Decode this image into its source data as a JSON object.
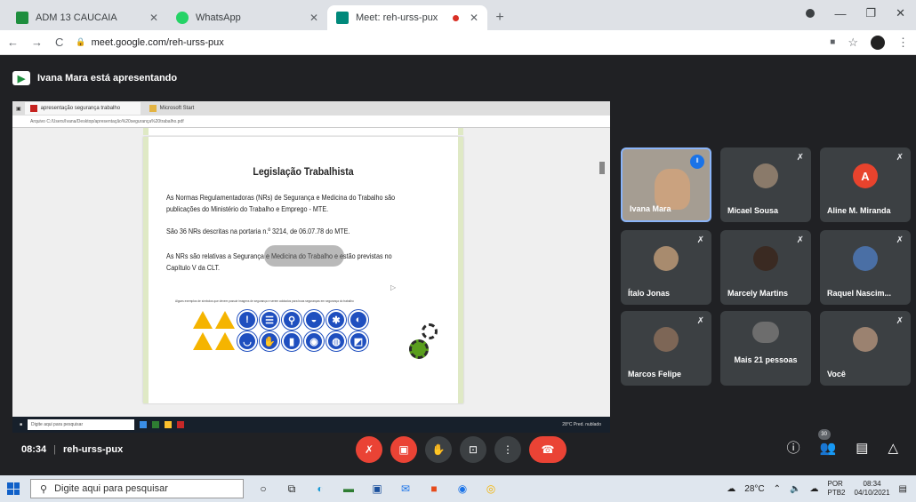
{
  "browser": {
    "tabs": [
      {
        "label": "ADM 13 CAUCAIA",
        "favicon_color": "#1e8e3e",
        "active": false
      },
      {
        "label": "WhatsApp",
        "favicon_color": "#25d366",
        "active": false
      },
      {
        "label": "Meet: reh-urss-pux",
        "favicon_color": "#00897b",
        "active": true
      }
    ],
    "new_tab": "+",
    "url": "meet.google.com/reh-urss-pux"
  },
  "meet": {
    "presenter_banner": "Ivana Mara está apresentando",
    "meeting_time": "08:34",
    "meeting_code": "reh-urss-pux",
    "people_count": "30",
    "participants": [
      {
        "name": "Ivana Mara",
        "speaking": true
      },
      {
        "name": "Micael Sousa"
      },
      {
        "name": "Aline M. Miranda",
        "initial": "A"
      },
      {
        "name": "Ítalo Jonas"
      },
      {
        "name": "Marcely Martins"
      },
      {
        "name": "Raquel Nascim..."
      },
      {
        "name": "Marcos Felipe"
      },
      {
        "name": "Mais 21 pessoas"
      },
      {
        "name": "Você"
      }
    ]
  },
  "shared_screen": {
    "tabs": [
      "apresentação segurança trabalho",
      "Microsoft Start"
    ],
    "address": "Arquivo  C:/Users/Ivana/Desktop/apresentação%20segurança%20trabalho.pdf",
    "slide": {
      "title": "Legislação Trabalhista",
      "p1": "As Normas Regulamentadoras (NRs) de Segurança e Medicina do Trabalho são publicações do Ministério do Trabalho e Emprego - MTE.",
      "p2": "São 36 NRs descritas na portaria n.º 3214, de 06.07.78 do MTE.",
      "p3": "As NRs são relativas a Segurança e Medicina do Trabalho e estão previstas no Capítulo V da CLT.",
      "small": "Alguns exemplos de símbolos que devem possuir imagens de segurança e serem adotados para boas seguranças em segurança do trabalho"
    },
    "taskbar": {
      "search": "Digite aqui para pesquisar",
      "tray": "28°C Pred. nublado"
    }
  },
  "windows": {
    "search_placeholder": "Digite aqui para pesquisar",
    "weather": "28°C",
    "lang_top": "POR",
    "lang_bottom": "PTB2",
    "time": "08:34",
    "date": "04/10/2021"
  }
}
